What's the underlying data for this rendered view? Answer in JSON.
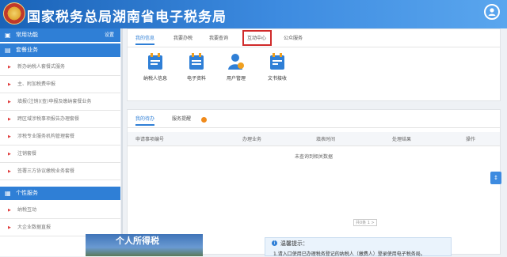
{
  "header": {
    "title": "国家税务总局湖南省电子税务局"
  },
  "sidebar": {
    "section1": {
      "title": "常用功能",
      "settings_label": "设置"
    },
    "section2": {
      "title": "套餐业务"
    },
    "items": [
      "新办纳税人套餐式服务",
      "主、附加税费申报",
      "填报(注销)(查)申报及缴纳套餐业务",
      "跨区域涉税事项报告办理套餐",
      "涉税专业服务机构管理套餐",
      "注销套餐",
      "签署三方协议缴税业务套餐"
    ],
    "section3": {
      "title": "个性服务"
    },
    "personal_items": [
      "纳税互动",
      "大企业数据直报"
    ]
  },
  "panel1": {
    "tabs": [
      "我的信息",
      "我要办税",
      "我要查询",
      "互动中心",
      "公众服务"
    ],
    "tools": [
      {
        "label": "纳税人信息",
        "icon": "taxpayer-info-icon"
      },
      {
        "label": "电子资料",
        "icon": "electronic-docs-icon"
      },
      {
        "label": "用户管理",
        "icon": "user-manage-icon"
      },
      {
        "label": "文书接收",
        "icon": "document-receive-icon"
      }
    ]
  },
  "panel2": {
    "tabs": [
      "我的待办",
      "服务提醒"
    ],
    "columns": [
      "申请事项编号",
      "办理业务",
      "填表时间",
      "处理结果",
      "操作"
    ],
    "empty_text": "未查询到相关数据",
    "pager_info": "共0条 1 >"
  },
  "bottom": {
    "banner_text": "个人所得税",
    "tips_title": "温馨提示：",
    "tips_line": "1.请入口使用已办理税务登记的纳税人（缴费人）登录使用电子税务局。"
  },
  "scroll_handle": "↕",
  "colors": {
    "header": "#2f7fd6",
    "accent": "#2f7fd6",
    "highlight": "#d02a2a"
  }
}
